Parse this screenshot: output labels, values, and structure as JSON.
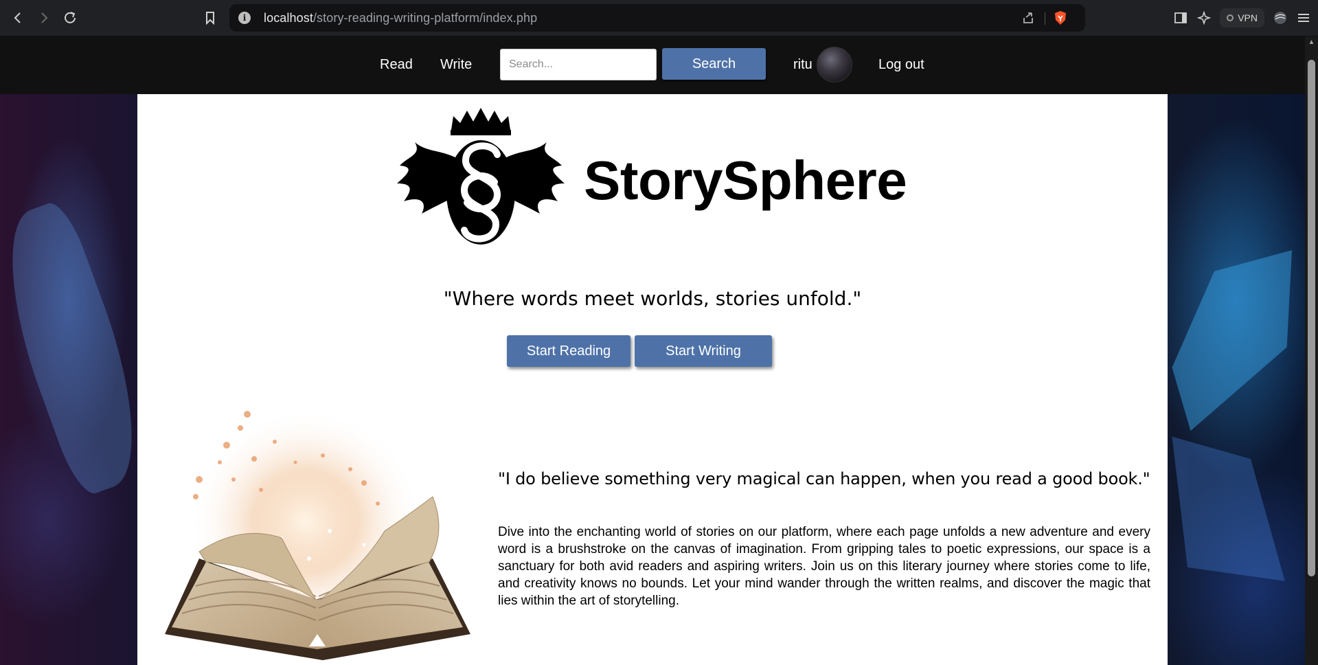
{
  "browser": {
    "url_host": "localhost",
    "url_path": "/story-reading-writing-platform/index.php",
    "vpn_label": "VPN"
  },
  "header": {
    "nav": {
      "read": "Read",
      "write": "Write"
    },
    "search": {
      "placeholder": "Search...",
      "button": "Search"
    },
    "user": {
      "name": "ritu"
    },
    "logout": "Log out"
  },
  "main": {
    "site_title": "StorySphere",
    "tagline": "\"Where words meet worlds, stories unfold.\"",
    "buttons": {
      "start_reading": "Start Reading",
      "start_writing": "Start Writing"
    },
    "quote": "\"I do believe something very magical can happen, when you read a good book.\"",
    "intro": "Dive into the enchanting world of stories on our platform, where each page unfolds a new adventure and every word is a brushstroke on the canvas of imagination. From gripping tales to poetic expressions, our space is a sanctuary for both avid readers and aspiring writers. Join us on this literary journey where stories come to life, and creativity knows no bounds. Let your mind wander through the written realms, and discover the magic that lies within the art of storytelling."
  },
  "colors": {
    "accent_button": "#4e72a8",
    "header_bg": "#111111",
    "card_bg": "#ffffff"
  },
  "icons": [
    "back-icon",
    "forward-icon",
    "reload-icon",
    "bookmark-icon",
    "info-icon",
    "share-icon",
    "brave-shield-icon",
    "sidebar-icon",
    "leo-ai-icon",
    "vpn-icon",
    "profile-icon",
    "menu-icon"
  ]
}
